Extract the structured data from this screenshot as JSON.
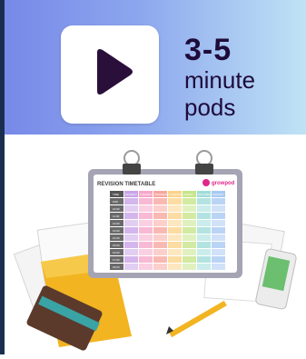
{
  "banner": {
    "headline_big": "3-5",
    "headline_line2": "minute",
    "headline_line3": "pods"
  },
  "timetable": {
    "title": "REVISION TIMETABLE",
    "brand": "growpod",
    "day_headers": [
      "MONDAY",
      "TUESDAY",
      "WEDNESDAY",
      "THURSDAY",
      "FRIDAY",
      "SATURDAY",
      "SUNDAY"
    ],
    "time_col_header": "TIME",
    "times": [
      "9:00",
      "10:00",
      "11:00",
      "12:00",
      "13:00",
      "14:00",
      "15:00",
      "16:00",
      "17:00",
      "18:00"
    ]
  },
  "colors": {
    "banner_left": "#7789e8",
    "banner_right": "#bfe3f5",
    "play_icon": "#2a0f3b",
    "headline": "#1e0b3a",
    "day_columns": [
      "#c9a4e8",
      "#f6a8c9",
      "#f7a7a0",
      "#fbd38b",
      "#c7e58a",
      "#9fdcd9",
      "#a9c9f2"
    ]
  }
}
